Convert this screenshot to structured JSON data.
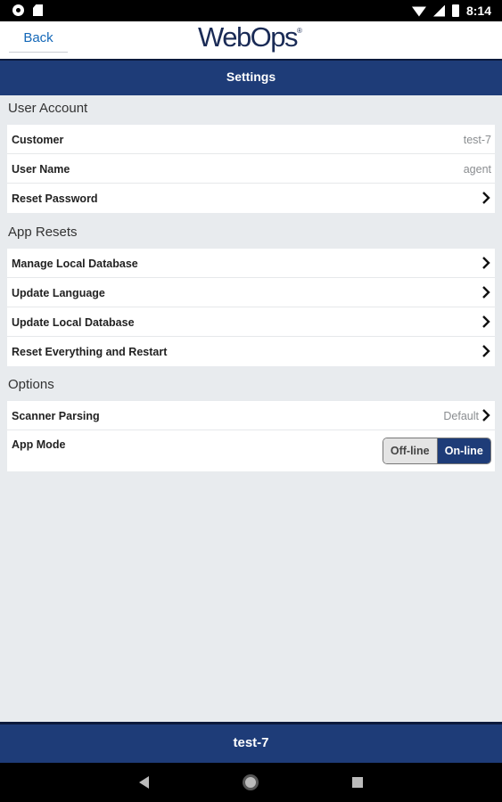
{
  "status_bar": {
    "time": "8:14"
  },
  "header": {
    "back_label": "Back",
    "logo_text": "WebOps",
    "logo_mark": "®"
  },
  "title": "Settings",
  "sections": {
    "user_account": {
      "title": "User Account",
      "rows": [
        {
          "label": "Customer",
          "value": "test-7"
        },
        {
          "label": "User Name",
          "value": "agent"
        },
        {
          "label": "Reset Password"
        }
      ]
    },
    "app_resets": {
      "title": "App Resets",
      "rows": [
        {
          "label": "Manage Local Database"
        },
        {
          "label": "Update Language"
        },
        {
          "label": "Update Local Database"
        },
        {
          "label": "Reset Everything and Restart"
        }
      ]
    },
    "options": {
      "title": "Options",
      "rows": [
        {
          "label": "Scanner Parsing",
          "value": "Default"
        },
        {
          "label": "App Mode",
          "toggle_off": "Off-line",
          "toggle_on": "On-line",
          "selected": "On-line"
        }
      ]
    }
  },
  "footer": {
    "text": "test-7"
  },
  "colors": {
    "primary": "#1e3c78",
    "link": "#1468b8",
    "background": "#e8ebee"
  }
}
